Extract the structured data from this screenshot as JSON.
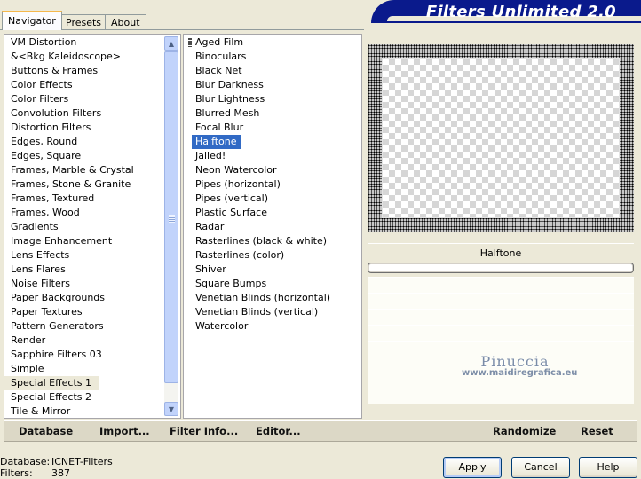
{
  "tabs": [
    {
      "label": "Navigator",
      "active": true
    },
    {
      "label": "Presets",
      "active": false
    },
    {
      "label": "About",
      "active": false
    }
  ],
  "app_title": "Filters Unlimited 2.0",
  "categories": [
    "VM Distortion",
    "&<Bkg Kaleidoscope>",
    "Buttons & Frames",
    "Color Effects",
    "Color Filters",
    "Convolution Filters",
    "Distortion Filters",
    "Edges, Round",
    "Edges, Square",
    "Frames, Marble & Crystal",
    "Frames, Stone & Granite",
    "Frames, Textured",
    "Frames, Wood",
    "Gradients",
    "Image Enhancement",
    "Lens Effects",
    "Lens Flares",
    "Noise Filters",
    "Paper Backgrounds",
    "Paper Textures",
    "Pattern Generators",
    "Render",
    "Sapphire Filters 03",
    "Simple",
    "Special Effects 1",
    "Special Effects 2",
    "Tile & Mirror"
  ],
  "selected_category": "Special Effects 1",
  "filters": [
    "Aged Film",
    "Binoculars",
    "Black Net",
    "Blur Darkness",
    "Blur Lightness",
    "Blurred Mesh",
    "Focal Blur",
    "Halftone",
    "Jailed!",
    "Neon Watercolor",
    "Pipes (horizontal)",
    "Pipes (vertical)",
    "Plastic Surface",
    "Radar",
    "Rasterlines (black & white)",
    "Rasterlines (color)",
    "Shiver",
    "Square Bumps",
    "Venetian Blinds (horizontal)",
    "Venetian Blinds (vertical)",
    "Watercolor"
  ],
  "selected_filter": "Halftone",
  "preview": {
    "filter_name": "Halftone"
  },
  "watermark": {
    "name": "Pinuccia",
    "url": "www.maidiregrafica.eu"
  },
  "toolbar": {
    "database": "Database",
    "import": "Import...",
    "filter_info": "Filter Info...",
    "editor": "Editor...",
    "randomize": "Randomize",
    "reset": "Reset"
  },
  "status": {
    "database_label": "Database:",
    "database_value": "ICNET-Filters",
    "filters_label": "Filters:",
    "filters_value": "387"
  },
  "buttons": {
    "apply": "Apply",
    "cancel": "Cancel",
    "help": "Help"
  },
  "colors": {
    "banner": "#0a1a8c",
    "selection": "#316ac5",
    "tab_highlight": "#f5b84c"
  },
  "icons": {
    "scroll_up": "chevron-up-icon",
    "scroll_down": "chevron-down-icon"
  }
}
